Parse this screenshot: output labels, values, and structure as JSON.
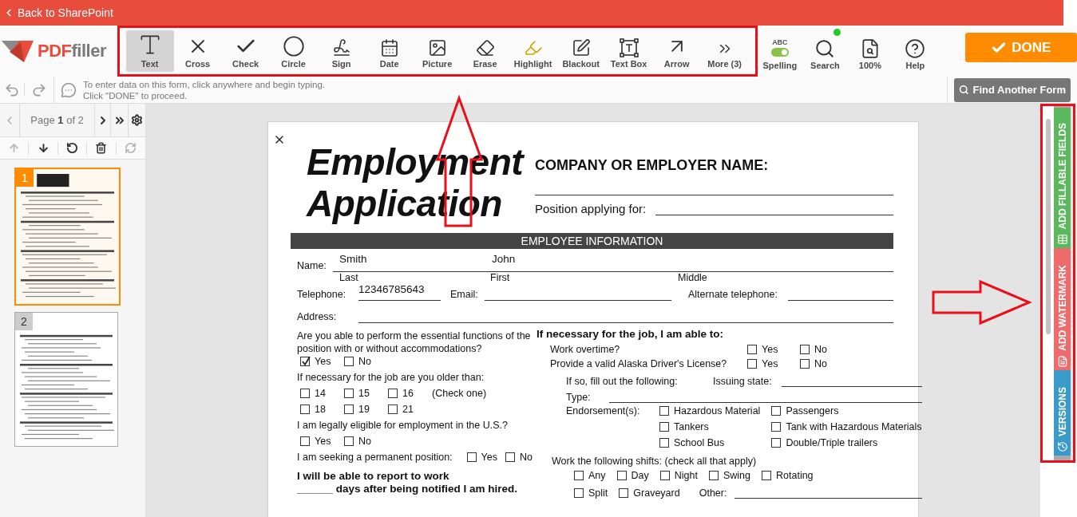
{
  "top_bar": {
    "back_link": "Back to SharePoint"
  },
  "logo": {
    "part_1": "PDF",
    "part_2": "filler"
  },
  "tools": [
    {
      "kind": "text",
      "label": "Text",
      "selected": true
    },
    {
      "kind": "cross",
      "label": "Cross",
      "selected": false
    },
    {
      "kind": "check",
      "label": "Check",
      "selected": false
    },
    {
      "kind": "circle",
      "label": "Circle",
      "selected": false
    },
    {
      "kind": "sign",
      "label": "Sign",
      "selected": false
    },
    {
      "kind": "date",
      "label": "Date",
      "selected": false
    },
    {
      "kind": "picture",
      "label": "Picture",
      "selected": false
    },
    {
      "kind": "erase",
      "label": "Erase",
      "selected": false
    },
    {
      "kind": "highlight",
      "label": "Highlight",
      "selected": false
    },
    {
      "kind": "blackout",
      "label": "Blackout",
      "selected": false
    },
    {
      "kind": "textbox",
      "label": "Text Box",
      "selected": false
    },
    {
      "kind": "arrow",
      "label": "Arrow",
      "selected": false
    },
    {
      "kind": "more",
      "label": "More (3)",
      "selected": false
    }
  ],
  "utilities": [
    {
      "kind": "spelling",
      "caption": "ABC",
      "label": "Spelling",
      "on": true
    },
    {
      "kind": "search",
      "label": "Search",
      "indicator": true
    },
    {
      "kind": "zoom",
      "label": "100%"
    },
    {
      "kind": "help",
      "label": "Help"
    }
  ],
  "done_button": "DONE",
  "hint_lines": [
    "To enter data on this form, click anywhere and begin typing.",
    "Click \"DONE\" to proceed."
  ],
  "find_button": "Find Another Form",
  "pager": "Page **1** of 2",
  "thumbnails": [
    {
      "number": "1",
      "selected": true
    },
    {
      "number": "2",
      "selected": false
    }
  ],
  "side_tabs": [
    {
      "label": "ADD FILLABLE FIELDS",
      "kind": "fields",
      "color": "#5cb85c"
    },
    {
      "label": "ADD WATERMARK",
      "kind": "watermark",
      "color": "#ef6b6b"
    },
    {
      "label": "VERSIONS",
      "kind": "versions",
      "color": "#3a9ac9"
    }
  ],
  "document": {
    "title_lines": [
      "Employment",
      "Application"
    ],
    "company_label": "COMPANY OR EMPLOYER NAME:",
    "position_label": "Position applying for:",
    "section_title": "EMPLOYEE INFORMATION",
    "name_label": "Name:",
    "last_name": "Smith",
    "first_name": "John",
    "name_sublabels": [
      "Last",
      "First",
      "Middle"
    ],
    "telephone_label": "Telephone:",
    "telephone": "12346785643",
    "email_label": "Email:",
    "alt_telephone_label": "Alternate telephone:",
    "address_label": "Address:",
    "left_items": [
      {
        "kind": "question",
        "text": "Are you able to perform the essential functions of the position with or without accommodations?"
      },
      {
        "kind": "options",
        "options": [
          {
            "label": "Yes",
            "checked": true
          },
          {
            "label": "No",
            "checked": false
          }
        ]
      },
      {
        "kind": "question",
        "text": "If necessary for the job are you older than:"
      },
      {
        "kind": "options",
        "options": [
          {
            "label": "14",
            "checked": false
          },
          {
            "label": "15",
            "checked": false
          },
          {
            "label": "16",
            "checked": false
          }
        ],
        "note": "(Check one)"
      },
      {
        "kind": "options",
        "options": [
          {
            "label": "18",
            "checked": false
          },
          {
            "label": "19",
            "checked": false
          },
          {
            "label": "21",
            "checked": false
          }
        ]
      },
      {
        "kind": "question",
        "text": "I am legally eligible for employment in the U.S.?"
      },
      {
        "kind": "options",
        "options": [
          {
            "label": "Yes",
            "checked": false
          },
          {
            "label": "No",
            "checked": false
          }
        ]
      },
      {
        "kind": "inline",
        "text": "I am seeking a permanent position:",
        "options": [
          {
            "label": "Yes",
            "checked": false
          },
          {
            "label": "No",
            "checked": false
          }
        ]
      },
      {
        "kind": "statement",
        "lines": [
          "I will be able to report to work",
          "______ days after being notified I am hired."
        ]
      }
    ],
    "right_heading": "If necessary for the job, I am able to:",
    "right_items": [
      {
        "kind": "yes_no",
        "text": "Work overtime?",
        "options": [
          {
            "label": "Yes",
            "checked": false
          },
          {
            "label": "No",
            "checked": false
          }
        ]
      },
      {
        "kind": "yes_no",
        "text": "Provide a valid Alaska Driver's License?",
        "options": [
          {
            "label": "Yes",
            "checked": false
          },
          {
            "label": "No",
            "checked": false
          }
        ]
      },
      {
        "kind": "fill",
        "text": "If so, fill out the following:",
        "field_label": "Issuing state:"
      },
      {
        "kind": "fill",
        "text": "Type:"
      },
      {
        "kind": "grid",
        "text": "Endorsement(s):",
        "options": [
          {
            "label": "Hazardous Material",
            "checked": false
          },
          {
            "label": "Passengers",
            "checked": false
          },
          {
            "label": "Tankers",
            "checked": false
          },
          {
            "label": "Tank with Hazardous Materials",
            "checked": false
          },
          {
            "label": "School Bus",
            "checked": false
          },
          {
            "label": "Double/Triple trailers",
            "checked": false
          }
        ]
      },
      {
        "kind": "caption",
        "text": "Work the following shifts: (check all that apply)"
      },
      {
        "kind": "row",
        "options": [
          {
            "label": "Any",
            "checked": false
          },
          {
            "label": "Day",
            "checked": false
          },
          {
            "label": "Night",
            "checked": false
          },
          {
            "label": "Swing",
            "checked": false
          },
          {
            "label": "Rotating",
            "checked": false
          }
        ]
      },
      {
        "kind": "row",
        "options": [
          {
            "label": "Split",
            "checked": false
          },
          {
            "label": "Graveyard",
            "checked": false
          }
        ],
        "field_label": "Other:"
      }
    ]
  }
}
